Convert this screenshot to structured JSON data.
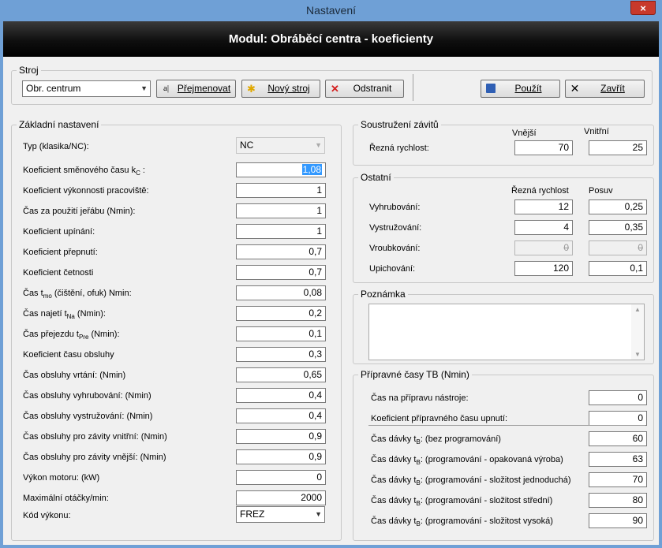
{
  "window": {
    "title": "Nastavení",
    "close": "×"
  },
  "header": {
    "title": "Modul: Obráběcí centra - koeficienty"
  },
  "stroj": {
    "legend": "Stroj",
    "selected": "Obr. centrum",
    "rename_label": "Přejmenovat",
    "new_label": "Nový stroj",
    "remove_label": "Odstranit",
    "apply_label": "Použít",
    "close_label": "Zavřít"
  },
  "zakladni": {
    "legend": "Základní nastavení",
    "typ_label": "Typ (klasika/NC):",
    "typ_value": "NC",
    "rows": [
      {
        "label_pre": "Koeficient směnového času k",
        "sub": "C",
        "label_post": " :",
        "value": "1,08"
      },
      {
        "label_pre": "Koeficient výkonnosti pracoviště:",
        "sub": "",
        "label_post": "",
        "value": "1"
      },
      {
        "label_pre": "Čas za použití jeřábu (Nmin):",
        "sub": "",
        "label_post": "",
        "value": "1"
      },
      {
        "label_pre": "Koeficient upínání:",
        "sub": "",
        "label_post": "",
        "value": "1"
      },
      {
        "label_pre": "Koeficient přepnutí:",
        "sub": "",
        "label_post": "",
        "value": "0,7"
      },
      {
        "label_pre": "Koeficient četnosti",
        "sub": "",
        "label_post": "",
        "value": "0,7"
      },
      {
        "label_pre": "Čas t",
        "sub": "mo",
        "label_post": " (čištění, ofuk) Nmin:",
        "value": "0,08"
      },
      {
        "label_pre": "Čas najetí t",
        "sub": "Na",
        "label_post": " (Nmin):",
        "value": "0,2"
      },
      {
        "label_pre": "Čas přejezdu t",
        "sub": "Pre",
        "label_post": " (Nmin):",
        "value": "0,1"
      },
      {
        "label_pre": "Koeficient času obsluhy",
        "sub": "",
        "label_post": "",
        "value": "0,3"
      },
      {
        "label_pre": "Čas obsluhy vrtání: (Nmin)",
        "sub": "",
        "label_post": "",
        "value": "0,65"
      },
      {
        "label_pre": "Čas obsluhy vyhrubování: (Nmin)",
        "sub": "",
        "label_post": "",
        "value": "0,4"
      },
      {
        "label_pre": "Čas obsluhy vystružování: (Nmin)",
        "sub": "",
        "label_post": "",
        "value": "0,4"
      },
      {
        "label_pre": "Čas obsluhy pro závity vnitřní: (Nmin)",
        "sub": "",
        "label_post": "",
        "value": "0,9"
      },
      {
        "label_pre": "Čas obsluhy pro závity vnější: (Nmin)",
        "sub": "",
        "label_post": "",
        "value": "0,9"
      },
      {
        "label_pre": "Výkon motoru: (kW)",
        "sub": "",
        "label_post": "",
        "value": "0"
      },
      {
        "label_pre": "Maximální otáčky/min:",
        "sub": "",
        "label_post": "",
        "value": "2000"
      }
    ],
    "kod_label": "Kód výkonu:",
    "kod_value": "FREZ"
  },
  "soustruzeni": {
    "legend": "Soustružení závitů",
    "col1": "Vnější",
    "col2": "Vnitřní",
    "row_label": "Řezná rychlost:",
    "v1": "70",
    "v2": "25"
  },
  "ostatni": {
    "legend": "Ostatní",
    "col1": "Řezná rychlost",
    "col2": "Posuv",
    "rows": [
      {
        "label": "Vyhrubování:",
        "v1": "12",
        "v2": "0,25",
        "disabled": false
      },
      {
        "label": "Vystružování:",
        "v1": "4",
        "v2": "0,35",
        "disabled": false
      },
      {
        "label": "Vroubkování:",
        "v1": "0",
        "v2": "0",
        "disabled": true
      },
      {
        "label": "Upichování:",
        "v1": "120",
        "v2": "0,1",
        "disabled": false
      }
    ]
  },
  "poznamka": {
    "legend": "Poznámka",
    "text": ""
  },
  "pripravne": {
    "legend": "Přípravné časy TB (Nmin)",
    "rows_top": [
      {
        "label": "Čas na přípravu nástroje:",
        "value": "0"
      },
      {
        "label": "Koeficient přípravného času upnutí:",
        "value": "0"
      }
    ],
    "rows_bottom": [
      {
        "pre": "Čas dávky t",
        "sub": "B",
        "post": ": (bez programování)",
        "value": "60"
      },
      {
        "pre": "Čas dávky t",
        "sub": "B",
        "post": ": (programování - opakovaná výroba)",
        "value": "63"
      },
      {
        "pre": "Čas dávky t",
        "sub": "B",
        "post": ": (programování - složitost jednoduchá)",
        "value": "70"
      },
      {
        "pre": "Čas dávky t",
        "sub": "B",
        "post": ": (programování - složitost střední)",
        "value": "80"
      },
      {
        "pre": "Čas dávky t",
        "sub": "B",
        "post": ": (programování - složitost vysoká)",
        "value": "90"
      }
    ]
  },
  "icons": {
    "rename": "rename-icon",
    "new": "new-file-icon",
    "remove": "delete-x-icon",
    "apply": "save-disk-icon",
    "close": "close-x-icon"
  }
}
